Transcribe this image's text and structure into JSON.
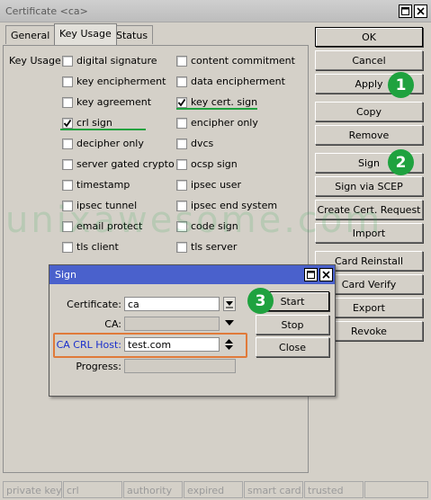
{
  "window": {
    "title": "Certificate <ca>"
  },
  "tabs": [
    {
      "label": "General",
      "active": false
    },
    {
      "label": "Key Usage",
      "active": true
    },
    {
      "label": "Status",
      "active": false
    }
  ],
  "key_usage": {
    "label": "Key Usage:",
    "left": [
      {
        "label": "digital signature",
        "checked": false
      },
      {
        "label": "key encipherment",
        "checked": false
      },
      {
        "label": "key agreement",
        "checked": false
      },
      {
        "label": "crl sign",
        "checked": true
      },
      {
        "label": "decipher only",
        "checked": false
      },
      {
        "label": "server gated crypto",
        "checked": false
      },
      {
        "label": "timestamp",
        "checked": false
      },
      {
        "label": "ipsec tunnel",
        "checked": false
      },
      {
        "label": "email protect",
        "checked": false
      },
      {
        "label": "tls client",
        "checked": false
      }
    ],
    "right": [
      {
        "label": "content commitment",
        "checked": false
      },
      {
        "label": "data encipherment",
        "checked": false
      },
      {
        "label": "key cert. sign",
        "checked": true
      },
      {
        "label": "encipher only",
        "checked": false
      },
      {
        "label": "dvcs",
        "checked": false
      },
      {
        "label": "ocsp sign",
        "checked": false
      },
      {
        "label": "ipsec user",
        "checked": false
      },
      {
        "label": "ipsec end system",
        "checked": false
      },
      {
        "label": "code sign",
        "checked": false
      },
      {
        "label": "tls server",
        "checked": false
      }
    ]
  },
  "buttons": [
    "OK",
    "Cancel",
    "Apply",
    "Copy",
    "Remove",
    "Sign",
    "Sign via SCEP",
    "Create Cert. Request",
    "Import",
    "Card Reinstall",
    "Card Verify",
    "Export",
    "Revoke"
  ],
  "badges": [
    "1",
    "2",
    "3"
  ],
  "watermark": "unixawesome.com",
  "sign_dialog": {
    "title": "Sign",
    "certificate_label": "Certificate:",
    "certificate_value": "ca",
    "ca_label": "CA:",
    "ca_value": "",
    "crl_host_label": "CA CRL Host:",
    "crl_host_value": "test.com",
    "progress_label": "Progress:",
    "progress_value": "",
    "start_label": "Start",
    "stop_label": "Stop",
    "close_label": "Close"
  },
  "status_bar": [
    "private key",
    "crl",
    "authority",
    "expired",
    "smart card...",
    "trusted",
    ""
  ],
  "colors": {
    "highlight_green": "#1fa23f",
    "dialog_title": "#4a61cc",
    "highlight_orange": "#e07a3a",
    "crl_host_label": "#1a2fcc"
  }
}
